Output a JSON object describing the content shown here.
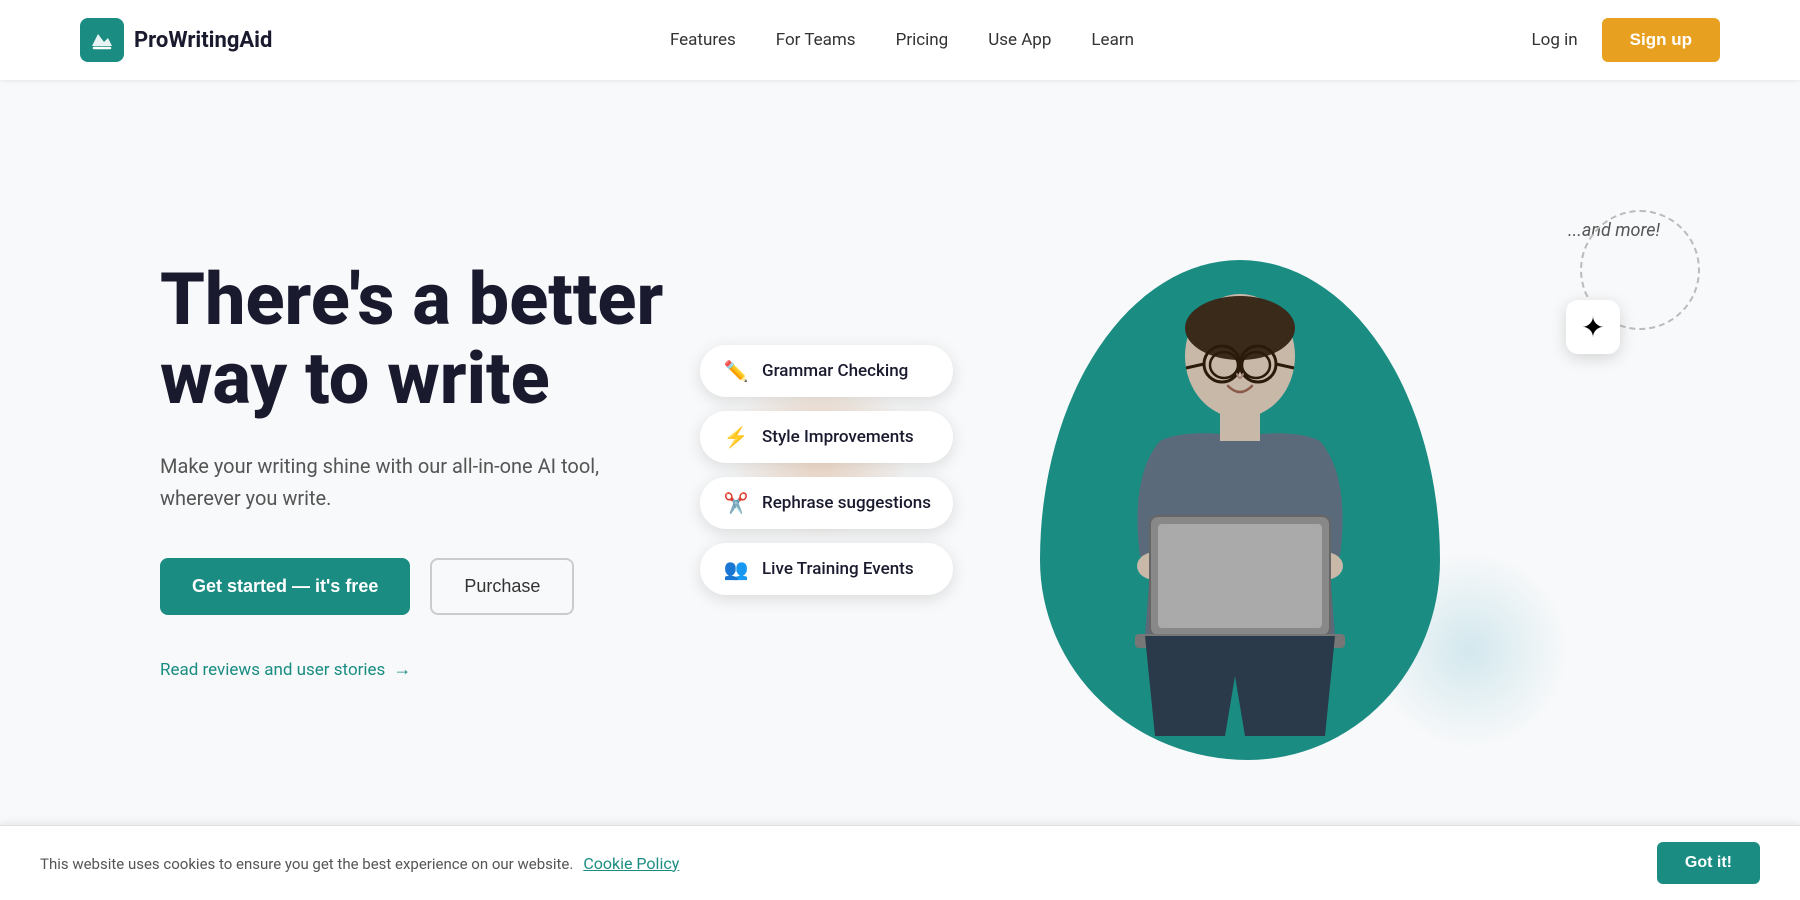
{
  "brand": {
    "name": "ProWritingAid",
    "logo_alt": "ProWritingAid Logo"
  },
  "nav": {
    "links": [
      {
        "id": "features",
        "label": "Features"
      },
      {
        "id": "for-teams",
        "label": "For Teams"
      },
      {
        "id": "pricing",
        "label": "Pricing"
      },
      {
        "id": "use-app",
        "label": "Use App"
      },
      {
        "id": "learn",
        "label": "Learn"
      }
    ],
    "login_label": "Log in",
    "signup_label": "Sign up"
  },
  "hero": {
    "title": "There's a better way to write",
    "subtitle": "Make your writing shine with our all-in-one AI tool, wherever you write.",
    "cta_primary": "Get started  — it's free",
    "cta_secondary": "Purchase",
    "reviews_link": "Read reviews and user stories"
  },
  "features": [
    {
      "id": "grammar-checking",
      "icon": "✏️",
      "label": "Grammar Checking"
    },
    {
      "id": "style-improvements",
      "icon": "⚡",
      "label": "Style Improvements"
    },
    {
      "id": "rephrase-suggestions",
      "icon": "✂️",
      "label": "Rephrase suggestions"
    },
    {
      "id": "live-training-events",
      "icon": "👥",
      "label": "Live Training Events"
    }
  ],
  "and_more": "...and more!",
  "cookie": {
    "text": "This website uses cookies to ensure you get the best experience on our website.",
    "link_text": "Cookie Policy",
    "button_label": "Got it!"
  },
  "colors": {
    "teal": "#1a8c82",
    "orange": "#e8a020",
    "dark": "#1a1a2e"
  }
}
